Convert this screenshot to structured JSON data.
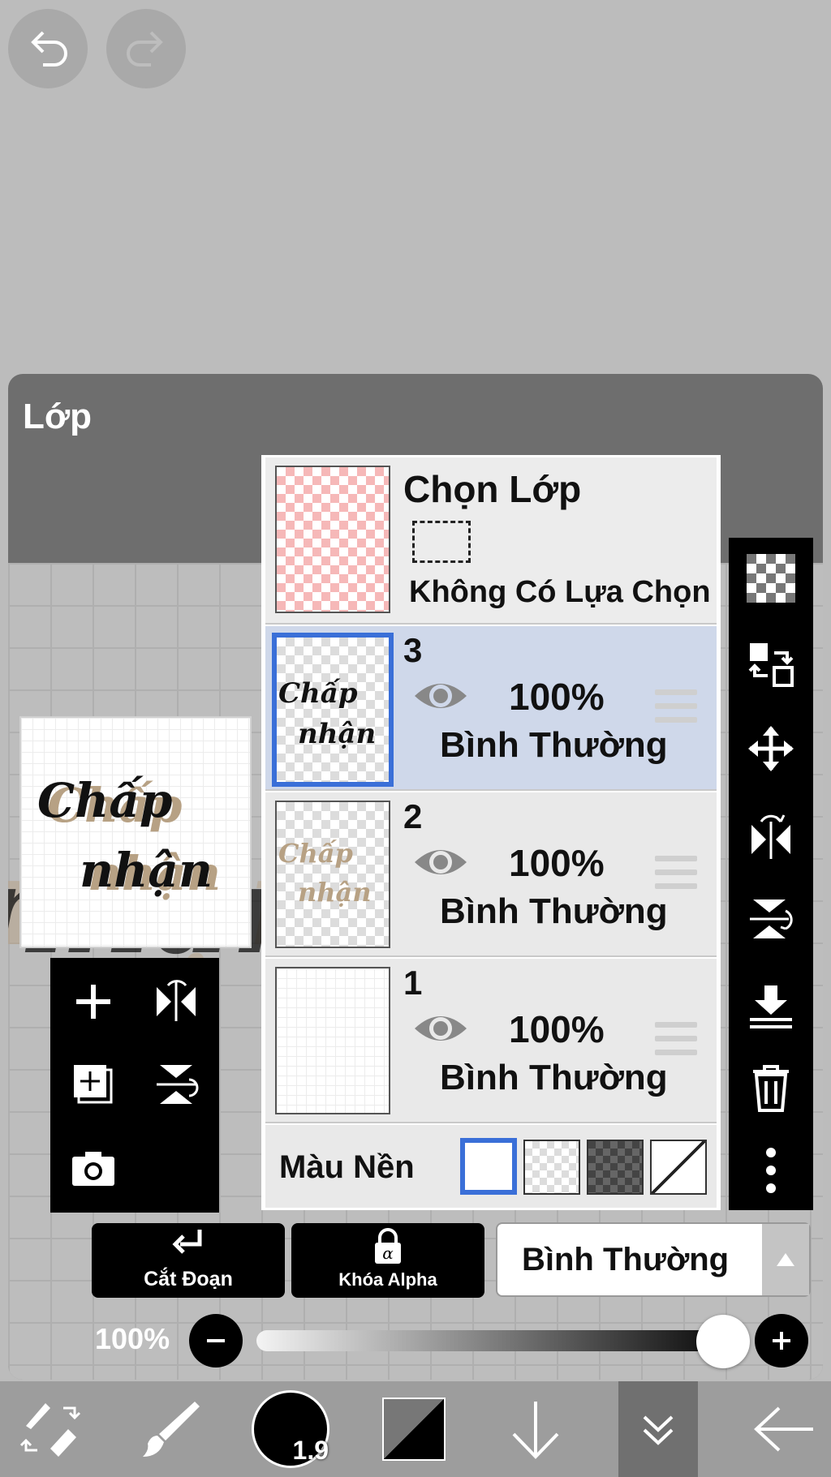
{
  "panel": {
    "title": "Lớp"
  },
  "selection_layer": {
    "title": "Chọn Lớp",
    "status": "Không Có Lựa Chọn"
  },
  "layers": [
    {
      "number": "3",
      "opacity": "100%",
      "blend_mode": "Bình Thường",
      "selected": true
    },
    {
      "number": "2",
      "opacity": "100%",
      "blend_mode": "Bình Thường",
      "selected": false
    },
    {
      "number": "1",
      "opacity": "100%",
      "blend_mode": "Bình Thường",
      "selected": false
    }
  ],
  "background_color": {
    "label": "Màu Nền"
  },
  "actions": {
    "clipping_label": "Cắt Đoạn",
    "alpha_lock_label": "Khóa Alpha",
    "blend_mode_value": "Bình Thường"
  },
  "opacity_slider": {
    "label": "100%",
    "value": 1.0
  },
  "brush": {
    "size": "1.9"
  },
  "artwork_text": {
    "line1": "Chấp",
    "line2": "nhận"
  },
  "colors": {
    "accent": "#3a6fd8",
    "selected_layer_bg": "#cfd8ea",
    "panel_bg": "#6e6e6e"
  }
}
